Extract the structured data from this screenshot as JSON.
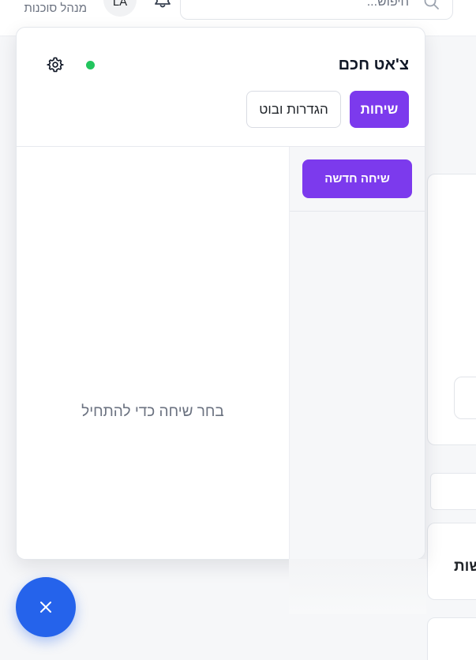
{
  "header": {
    "role_label": "מנהל סוכנות",
    "avatar_initials": "LA",
    "search_placeholder": "חיפוש..."
  },
  "background": {
    "card_title_fragment": "שות"
  },
  "chat": {
    "title": "צ'אט חכם",
    "status": "online",
    "tabs": {
      "chats_label": "שיחות",
      "settings_label": "הגדרות ובוט"
    },
    "sidebar": {
      "new_chat_label": "שיחה חדשה"
    },
    "empty_state": "בחר שיחה כדי להתחיל"
  },
  "colors": {
    "accent_purple": "#7c3aed",
    "fab_blue": "#2563eb",
    "status_green": "#22c55e"
  },
  "icons": {
    "settings": "gear-icon",
    "notifications": "bell-icon",
    "search": "search-icon",
    "close": "close-icon"
  }
}
